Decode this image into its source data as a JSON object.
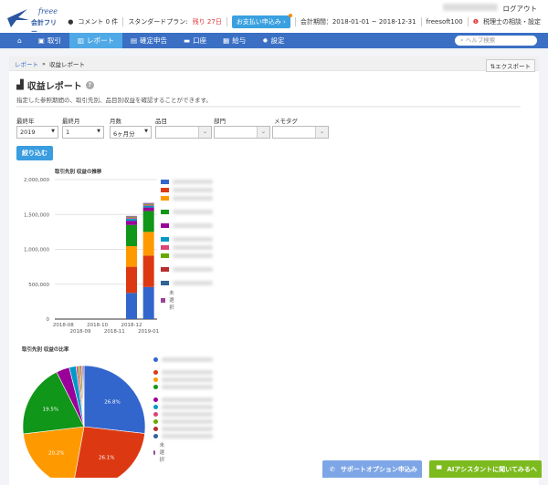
{
  "header": {
    "logo_brand": "freee",
    "logo_text": "会計フリー",
    "logout": "ログアウト",
    "comments": "コメント 0 件",
    "plan": "スタンダードプラン:",
    "plan_remaining": "残り 27日",
    "pay_button": "お支払い申込み",
    "period": "会計期間：2018-01-01 ~ 2018-12-31",
    "company": "freesoft100",
    "advisor": "税理士の相談・設定"
  },
  "nav": {
    "items": [
      {
        "label": "",
        "icon": "home-icon"
      },
      {
        "label": "取引",
        "icon": "inbox-icon"
      },
      {
        "label": "レポート",
        "icon": "chart-icon",
        "active": true
      },
      {
        "label": "確定申告",
        "icon": "book-icon"
      },
      {
        "label": "口座",
        "icon": "card-icon"
      },
      {
        "label": "給与",
        "icon": "calendar-icon"
      },
      {
        "label": "設定",
        "icon": "gear-icon"
      }
    ],
    "search_placeholder": "ヘルプ検索"
  },
  "breadcrumb": {
    "parent": "レポート",
    "sep": "»",
    "current": "収益レポート"
  },
  "export_label": "エクスポート",
  "page": {
    "title": "収益レポート",
    "description": "指定した参照期間の、取引先別、品目別収益を確認することができます。"
  },
  "filters": {
    "labels": [
      "最終年",
      "最終月",
      "月数",
      "品目",
      "部門",
      "メモタグ"
    ],
    "year": "2019",
    "month": "1",
    "months": "6ヶ月分",
    "submit": "絞り込む"
  },
  "colors": [
    "#3366cc",
    "#dc3912",
    "#ff9900",
    "#109618",
    "#990099",
    "#0099c6",
    "#dd4477",
    "#66aa00",
    "#b82e2e",
    "#316395",
    "#994499"
  ],
  "chart_data": [
    {
      "type": "bar",
      "stacked": true,
      "title": "取引先別 収益の推移",
      "categories": [
        "2018-08",
        "2018-09",
        "2018-10",
        "2018-11",
        "2018-12",
        "2019-01"
      ],
      "ylim": [
        0,
        2000000
      ],
      "yticks": [
        "0",
        "500,000",
        "1,000,000",
        "1,500,000",
        "2,000,000"
      ],
      "grid": true,
      "legend": "right",
      "series": [
        {
          "values": [
            0,
            0,
            0,
            0,
            375000,
            460000
          ]
        },
        {
          "values": [
            0,
            0,
            0,
            0,
            375000,
            450000
          ]
        },
        {
          "values": [
            0,
            0,
            0,
            0,
            295000,
            340000
          ]
        },
        {
          "values": [
            0,
            0,
            0,
            0,
            305000,
            300000
          ]
        },
        {
          "values": [
            0,
            0,
            0,
            0,
            60000,
            50000
          ]
        },
        {
          "values": [
            0,
            0,
            0,
            0,
            30000,
            25000
          ]
        },
        {
          "values": [
            0,
            0,
            0,
            0,
            12000,
            10000
          ]
        },
        {
          "values": [
            0,
            0,
            0,
            0,
            8000,
            8000
          ]
        },
        {
          "values": [
            0,
            0,
            0,
            0,
            7000,
            8000
          ]
        },
        {
          "values": [
            0,
            0,
            0,
            0,
            6000,
            7000
          ]
        },
        {
          "name": "未選択",
          "values": [
            0,
            0,
            0,
            0,
            6000,
            7000
          ]
        }
      ]
    },
    {
      "type": "pie",
      "title": "取引先別 収益の比率",
      "values": [
        26.8,
        26.1,
        20.2,
        19.5,
        3.5,
        1.8,
        0.6,
        0.5,
        0.4,
        0.3,
        0.3
      ],
      "labels": [
        "26.8%",
        "26.1%",
        "20.2%",
        "19.5%"
      ],
      "legend": "right",
      "last_legend": "未選択"
    }
  ],
  "footer": {
    "support": "サポートオプション申込み",
    "assistant": "AIアシスタントに聞いてみるへ"
  }
}
